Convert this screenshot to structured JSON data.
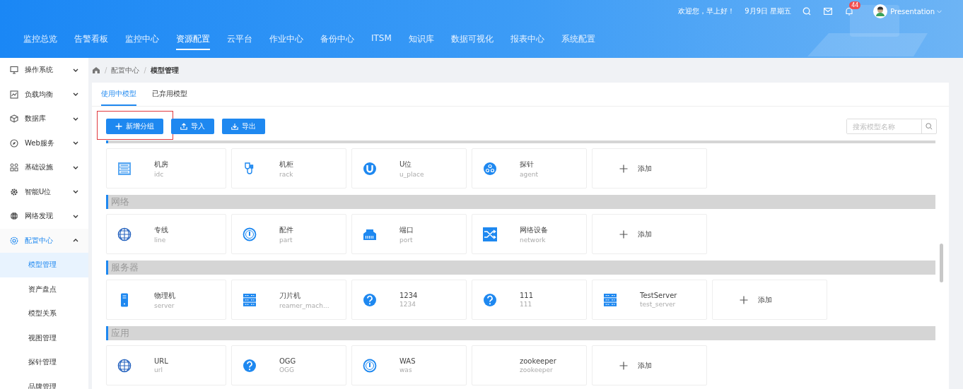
{
  "header": {
    "greeting": "欢迎您，早上好！",
    "date": "9月9日 星期五",
    "notification_count": "44",
    "user_name": "Presentation",
    "nav": [
      {
        "label": "监控总览",
        "selected": false
      },
      {
        "label": "告警看板",
        "selected": false
      },
      {
        "label": "监控中心",
        "selected": false
      },
      {
        "label": "资源配置",
        "selected": true
      },
      {
        "label": "云平台",
        "selected": false
      },
      {
        "label": "作业中心",
        "selected": false
      },
      {
        "label": "备份中心",
        "selected": false
      },
      {
        "label": "ITSM",
        "selected": false
      },
      {
        "label": "知识库",
        "selected": false
      },
      {
        "label": "数据可视化",
        "selected": false
      },
      {
        "label": "报表中心",
        "selected": false
      },
      {
        "label": "系统配置",
        "selected": false
      }
    ]
  },
  "sidebar": {
    "items": [
      {
        "label": "操作系统",
        "expanded": false
      },
      {
        "label": "负载均衡",
        "expanded": false
      },
      {
        "label": "数据库",
        "expanded": false
      },
      {
        "label": "Web服务",
        "expanded": false
      },
      {
        "label": "基础设施",
        "expanded": false
      },
      {
        "label": "智能U位",
        "expanded": false
      },
      {
        "label": "网络发现",
        "expanded": false
      },
      {
        "label": "配置中心",
        "expanded": true,
        "children": [
          {
            "label": "模型管理",
            "selected": true
          },
          {
            "label": "资产盘点",
            "selected": false
          },
          {
            "label": "模型关系",
            "selected": false
          },
          {
            "label": "视图管理",
            "selected": false
          },
          {
            "label": "探针管理",
            "selected": false
          },
          {
            "label": "品牌管理",
            "selected": false
          }
        ]
      }
    ]
  },
  "breadcrumb": [
    {
      "separator": "/",
      "label": "配置中心"
    },
    {
      "separator": "/",
      "label": "模型管理"
    }
  ],
  "tabs": [
    {
      "label": "使用中模型",
      "selected": true
    },
    {
      "label": "已弃用模型",
      "selected": false
    }
  ],
  "toolbar": {
    "buttons": [
      {
        "label": "新增分组",
        "highlighted": true
      },
      {
        "label": "导入",
        "highlighted": false
      },
      {
        "label": "导出",
        "highlighted": false
      }
    ],
    "search": {
      "placeholder": "搜索模型名称"
    }
  },
  "groups": [
    {
      "cards": [
        {
          "kind": "model",
          "name": "机房",
          "code": "idc"
        },
        {
          "kind": "model",
          "name": "机柜",
          "code": "rack"
        },
        {
          "kind": "model",
          "name": "U位",
          "code": "u_place"
        },
        {
          "kind": "model",
          "name": "探针",
          "code": "agent"
        },
        {
          "kind": "add",
          "name": "添加"
        }
      ]
    },
    {
      "title": "网络",
      "cards": [
        {
          "kind": "model",
          "name": "专线",
          "code": "line"
        },
        {
          "kind": "model",
          "name": "配件",
          "code": "part"
        },
        {
          "kind": "model",
          "name": "端口",
          "code": "port"
        },
        {
          "kind": "model",
          "name": "网络设备",
          "code": "network"
        },
        {
          "kind": "add",
          "name": "添加"
        }
      ]
    },
    {
      "title": "服务器",
      "cards": [
        {
          "kind": "model",
          "name": "物理机",
          "code": "server"
        },
        {
          "kind": "model",
          "name": "刀片机",
          "code": "reamer_mach..."
        },
        {
          "kind": "model",
          "name": "1234",
          "code": "1234"
        },
        {
          "kind": "model",
          "name": "111",
          "code": "111"
        },
        {
          "kind": "model",
          "name": "TestServer",
          "code": "test_server"
        },
        {
          "kind": "add",
          "name": "添加"
        }
      ]
    },
    {
      "title": "应用",
      "cards": [
        {
          "kind": "model",
          "name": "URL",
          "code": "url"
        },
        {
          "kind": "model",
          "name": "OGG",
          "code": "OGG"
        },
        {
          "kind": "model",
          "name": "WAS",
          "code": "was"
        },
        {
          "kind": "model",
          "name": "zookeeper",
          "code": "zookeeper"
        },
        {
          "kind": "add",
          "name": "添加"
        }
      ]
    }
  ]
}
